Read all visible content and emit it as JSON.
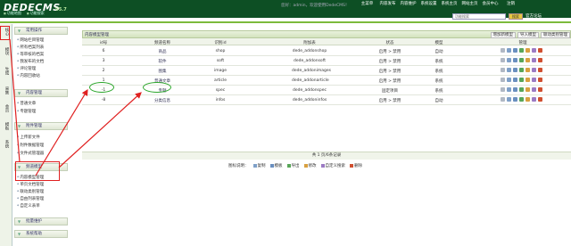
{
  "header": {
    "logo": "DEDECMS",
    "version": "V5.7",
    "user_info": "您好：admin，欢迎使用DedeCMS！",
    "nav": [
      "主菜单",
      "内容发布",
      "内容维护",
      "系统设置",
      "系统主页",
      "网站主页",
      "会员中心",
      "注销"
    ],
    "quick_links": [
      "功能地图",
      "功能搜索"
    ],
    "search_placeholder": "功能搜索",
    "search_button": "搜索",
    "site_link": "官方论坛"
  },
  "tabs": [
    "核心",
    "模块",
    "生成",
    "采集",
    "会员",
    "模板",
    "系统"
  ],
  "sidebar": {
    "sections": [
      {
        "title": "常用操作",
        "items": [
          "网站栏目管理",
          "所有档案列表",
          "等审核的档案",
          "我发布的文档",
          "评论管理",
          "内容回收站"
        ]
      },
      {
        "title": "内容管理",
        "items": [
          "普通文章",
          "专题管理"
        ]
      },
      {
        "title": "附件管理",
        "items": [
          "上传新文件",
          "附件数据管理",
          "文件式管理器"
        ]
      },
      {
        "title": "频道模型",
        "items": [
          "内容模型管理",
          "单页文档管理",
          "联动类别管理",
          "自由列表管理",
          "自定义表单"
        ]
      },
      {
        "title": "批量维护",
        "items": []
      },
      {
        "title": "系统帮助",
        "items": []
      }
    ]
  },
  "main": {
    "title": "内容模型管理",
    "actions": [
      "增加新模型",
      "导入模型",
      "联动类别管理"
    ],
    "columns": [
      "id号",
      "频道名称",
      "识别id",
      "附加表",
      "状态",
      "模型",
      "管理"
    ],
    "rows": [
      {
        "id": "6",
        "name": "商品",
        "nid": "shop",
        "table": "dede_addonshop",
        "status": "启用 > 禁用",
        "model": "自动"
      },
      {
        "id": "3",
        "name": "软件",
        "nid": "soft",
        "table": "dede_addonsoft",
        "status": "启用 > 禁用",
        "model": "系统"
      },
      {
        "id": "2",
        "name": "图集",
        "nid": "image",
        "table": "dede_addonimages",
        "status": "启用 > 禁用",
        "model": "系统"
      },
      {
        "id": "1",
        "name": "普通文章",
        "nid": "article",
        "table": "dede_addonarticle",
        "status": "启用 > 禁用",
        "model": "系统"
      },
      {
        "id": "-1",
        "name": "专题",
        "nid": "spec",
        "table": "dede_addonspec",
        "status": "固定项目",
        "model": "系统"
      },
      {
        "id": "-8",
        "name": "分类信息",
        "nid": "infos",
        "table": "dede_addoninfos",
        "status": "启用 > 禁用",
        "model": "自动"
      }
    ],
    "footer": "共 1 页/6条记录",
    "legend_label": "图标说明：",
    "legend": [
      "复制",
      "模板",
      "导出",
      "修改",
      "自定义搜索",
      "删除"
    ]
  }
}
